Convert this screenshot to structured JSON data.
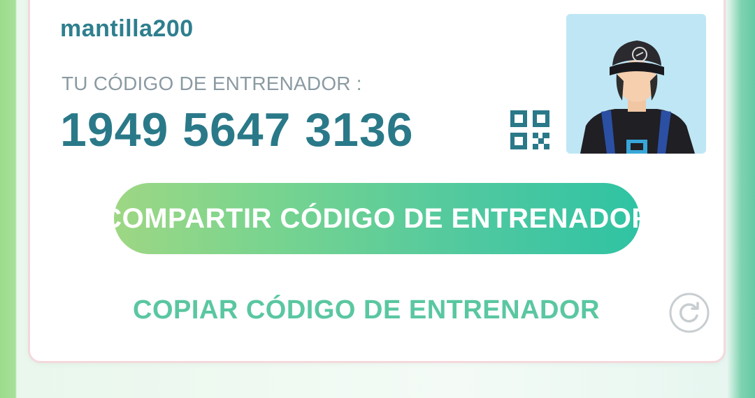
{
  "profile": {
    "username": "mantilla200",
    "code_label": "TU CÓDIGO DE ENTRENADOR :",
    "code_value": "1949 5647 3136"
  },
  "actions": {
    "share_label": "COMPARTIR CÓDIGO DE ENTRENADOR",
    "copy_label": "COPIAR CÓDIGO DE ENTRENADOR"
  },
  "icons": {
    "qr": "qr-code-icon",
    "refresh": "refresh-icon",
    "avatar": "trainer-avatar"
  },
  "colors": {
    "username": "#2e7f8e",
    "code_value": "#2a7989",
    "label": "#8b9aa2",
    "copy_text": "#5ac7a0",
    "button_start": "#9ed784",
    "button_end": "#2fc3a3"
  }
}
